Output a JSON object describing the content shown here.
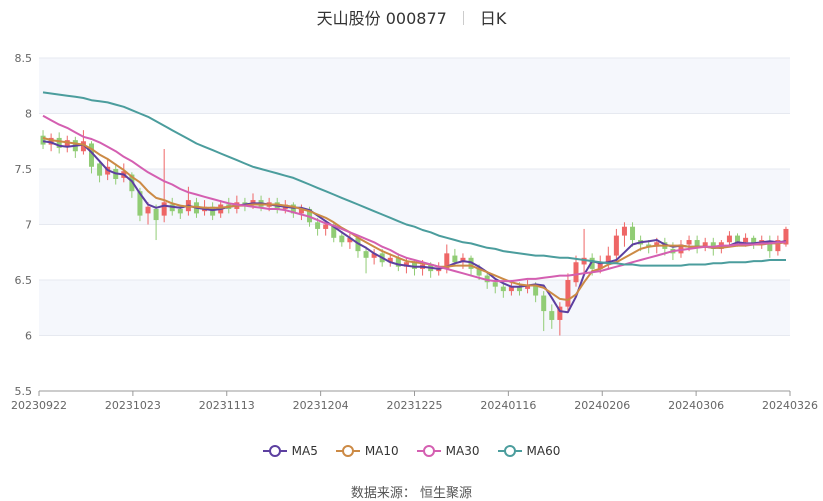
{
  "header": {
    "stock": "天山股份 000877",
    "period": "日K"
  },
  "source": "数据来源： 恒生聚源",
  "colors": {
    "up": "#ee6666",
    "down": "#91cc75",
    "grid_band": "#f5f7fc"
  },
  "chart_data": {
    "type": "candlestick",
    "title": "天山股份 000877",
    "ylim": [
      5.5,
      8.5
    ],
    "yticks": [
      "5.5",
      "6",
      "6.5",
      "7",
      "7.5",
      "8",
      "8.5"
    ],
    "x_tick_labels": [
      "20230922",
      "20231023",
      "20231113",
      "20231204",
      "20231225",
      "20240116",
      "20240206",
      "20240306",
      "20240326"
    ],
    "grid": true,
    "legend_position": "bottom",
    "series": [
      {
        "name": "MA5",
        "color": "#5c3fa0",
        "values": [
          7.75,
          7.74,
          7.71,
          7.7,
          7.71,
          7.72,
          7.65,
          7.57,
          7.49,
          7.46,
          7.45,
          7.39,
          7.28,
          7.18,
          7.15,
          7.17,
          7.16,
          7.15,
          7.17,
          7.15,
          7.14,
          7.13,
          7.14,
          7.16,
          7.17,
          7.18,
          7.19,
          7.19,
          7.18,
          7.17,
          7.16,
          7.15,
          7.15,
          7.13,
          7.08,
          7.03,
          6.98,
          6.93,
          6.88,
          6.83,
          6.79,
          6.74,
          6.7,
          6.66,
          6.64,
          6.63,
          6.62,
          6.62,
          6.61,
          6.6,
          6.62,
          6.65,
          6.67,
          6.66,
          6.62,
          6.57,
          6.51,
          6.47,
          6.44,
          6.44,
          6.45,
          6.46,
          6.45,
          6.34,
          6.22,
          6.21,
          6.35,
          6.55,
          6.67,
          6.65,
          6.66,
          6.68,
          6.75,
          6.82,
          6.84,
          6.85,
          6.86,
          6.82,
          6.8,
          6.81,
          6.8,
          6.8,
          6.8,
          6.79,
          6.79,
          6.81,
          6.84,
          6.83,
          6.83,
          6.84,
          6.85,
          6.84,
          6.85
        ]
      },
      {
        "name": "MA10",
        "color": "#cc8a45",
        "values": [
          7.78,
          7.76,
          7.75,
          7.74,
          7.73,
          7.72,
          7.68,
          7.63,
          7.59,
          7.54,
          7.49,
          7.43,
          7.38,
          7.3,
          7.24,
          7.22,
          7.19,
          7.17,
          7.16,
          7.16,
          7.15,
          7.15,
          7.15,
          7.16,
          7.17,
          7.17,
          7.18,
          7.18,
          7.18,
          7.18,
          7.17,
          7.16,
          7.14,
          7.12,
          7.09,
          7.06,
          7.02,
          6.97,
          6.93,
          6.88,
          6.84,
          6.8,
          6.76,
          6.73,
          6.7,
          6.67,
          6.66,
          6.65,
          6.64,
          6.62,
          6.62,
          6.63,
          6.63,
          6.63,
          6.6,
          6.57,
          6.54,
          6.51,
          6.48,
          6.46,
          6.45,
          6.45,
          6.43,
          6.38,
          6.33,
          6.32,
          6.37,
          6.48,
          6.58,
          6.6,
          6.64,
          6.66,
          6.7,
          6.74,
          6.78,
          6.8,
          6.81,
          6.81,
          6.81,
          6.81,
          6.8,
          6.8,
          6.8,
          6.79,
          6.79,
          6.8,
          6.81,
          6.81,
          6.82,
          6.82,
          6.83,
          6.83,
          6.84
        ]
      },
      {
        "name": "MA30",
        "color": "#d45fb1",
        "values": [
          7.98,
          7.94,
          7.9,
          7.87,
          7.83,
          7.79,
          7.77,
          7.74,
          7.7,
          7.66,
          7.61,
          7.57,
          7.52,
          7.47,
          7.43,
          7.39,
          7.36,
          7.32,
          7.29,
          7.27,
          7.25,
          7.23,
          7.21,
          7.19,
          7.18,
          7.17,
          7.16,
          7.15,
          7.14,
          7.14,
          7.13,
          7.11,
          7.09,
          7.07,
          7.04,
          7.01,
          6.99,
          6.96,
          6.93,
          6.9,
          6.87,
          6.84,
          6.8,
          6.77,
          6.73,
          6.7,
          6.68,
          6.66,
          6.64,
          6.62,
          6.6,
          6.58,
          6.56,
          6.54,
          6.52,
          6.5,
          6.49,
          6.49,
          6.49,
          6.5,
          6.51,
          6.51,
          6.52,
          6.53,
          6.54,
          6.54,
          6.55,
          6.56,
          6.57,
          6.58,
          6.6,
          6.62,
          6.64,
          6.66,
          6.68,
          6.7,
          6.72,
          6.74,
          6.76,
          6.77,
          6.78,
          6.79,
          6.8,
          6.8,
          6.81,
          6.81,
          6.82,
          6.82,
          6.82,
          6.83,
          6.83,
          6.84,
          6.84
        ]
      },
      {
        "name": "MA60",
        "color": "#4b9d9d",
        "values": [
          8.19,
          8.18,
          8.17,
          8.16,
          8.15,
          8.14,
          8.12,
          8.11,
          8.1,
          8.08,
          8.06,
          8.03,
          8.0,
          7.97,
          7.93,
          7.89,
          7.85,
          7.81,
          7.77,
          7.73,
          7.7,
          7.67,
          7.64,
          7.61,
          7.58,
          7.55,
          7.52,
          7.5,
          7.48,
          7.46,
          7.44,
          7.42,
          7.39,
          7.36,
          7.33,
          7.3,
          7.27,
          7.24,
          7.21,
          7.18,
          7.15,
          7.12,
          7.09,
          7.06,
          7.03,
          7.0,
          6.98,
          6.95,
          6.93,
          6.9,
          6.88,
          6.86,
          6.84,
          6.83,
          6.81,
          6.79,
          6.78,
          6.76,
          6.75,
          6.74,
          6.73,
          6.72,
          6.72,
          6.71,
          6.7,
          6.7,
          6.69,
          6.68,
          6.67,
          6.66,
          6.65,
          6.65,
          6.64,
          6.64,
          6.63,
          6.63,
          6.63,
          6.63,
          6.63,
          6.63,
          6.64,
          6.64,
          6.64,
          6.65,
          6.65,
          6.66,
          6.66,
          6.66,
          6.67,
          6.67,
          6.68,
          6.68,
          6.68
        ]
      }
    ],
    "candles": [
      [
        7.8,
        7.72,
        7.68,
        7.85
      ],
      [
        7.72,
        7.78,
        7.66,
        7.82
      ],
      [
        7.78,
        7.69,
        7.64,
        7.83
      ],
      [
        7.7,
        7.76,
        7.65,
        7.8
      ],
      [
        7.76,
        7.66,
        7.6,
        7.79
      ],
      [
        7.66,
        7.75,
        7.63,
        7.85
      ],
      [
        7.73,
        7.52,
        7.46,
        7.75
      ],
      [
        7.55,
        7.44,
        7.38,
        7.58
      ],
      [
        7.45,
        7.52,
        7.4,
        7.6
      ],
      [
        7.5,
        7.41,
        7.36,
        7.55
      ],
      [
        7.42,
        7.48,
        7.38,
        7.55
      ],
      [
        7.45,
        7.3,
        7.24,
        7.47
      ],
      [
        7.3,
        7.08,
        7.03,
        7.33
      ],
      [
        7.1,
        7.16,
        7.0,
        7.2
      ],
      [
        7.14,
        7.04,
        6.86,
        7.18
      ],
      [
        7.08,
        7.2,
        7.02,
        7.68
      ],
      [
        7.18,
        7.12,
        7.08,
        7.24
      ],
      [
        7.14,
        7.1,
        7.05,
        7.18
      ],
      [
        7.12,
        7.22,
        7.08,
        7.34
      ],
      [
        7.2,
        7.1,
        7.06,
        7.24
      ],
      [
        7.12,
        7.16,
        7.08,
        7.22
      ],
      [
        7.16,
        7.08,
        7.04,
        7.2
      ],
      [
        7.1,
        7.18,
        7.06,
        7.22
      ],
      [
        7.18,
        7.14,
        7.1,
        7.24
      ],
      [
        7.14,
        7.2,
        7.1,
        7.26
      ],
      [
        7.2,
        7.18,
        7.12,
        7.24
      ],
      [
        7.18,
        7.22,
        7.14,
        7.28
      ],
      [
        7.22,
        7.16,
        7.12,
        7.26
      ],
      [
        7.16,
        7.2,
        7.12,
        7.24
      ],
      [
        7.2,
        7.14,
        7.1,
        7.24
      ],
      [
        7.14,
        7.18,
        7.1,
        7.22
      ],
      [
        7.18,
        7.1,
        7.06,
        7.2
      ],
      [
        7.1,
        7.14,
        7.04,
        7.18
      ],
      [
        7.14,
        7.02,
        6.98,
        7.16
      ],
      [
        7.02,
        6.96,
        6.9,
        7.06
      ],
      [
        6.96,
        7.0,
        6.9,
        7.04
      ],
      [
        7.0,
        6.88,
        6.84,
        7.02
      ],
      [
        6.9,
        6.84,
        6.8,
        6.94
      ],
      [
        6.84,
        6.88,
        6.78,
        6.92
      ],
      [
        6.88,
        6.76,
        6.7,
        6.9
      ],
      [
        6.76,
        6.7,
        6.56,
        6.8
      ],
      [
        6.7,
        6.74,
        6.64,
        6.78
      ],
      [
        6.74,
        6.66,
        6.62,
        6.78
      ],
      [
        6.66,
        6.7,
        6.62,
        6.74
      ],
      [
        6.7,
        6.62,
        6.58,
        6.74
      ],
      [
        6.62,
        6.66,
        6.56,
        6.7
      ],
      [
        6.66,
        6.6,
        6.54,
        6.68
      ],
      [
        6.6,
        6.64,
        6.54,
        6.68
      ],
      [
        6.64,
        6.58,
        6.52,
        6.66
      ],
      [
        6.58,
        6.6,
        6.54,
        6.66
      ],
      [
        6.6,
        6.74,
        6.56,
        6.82
      ],
      [
        6.72,
        6.66,
        6.62,
        6.78
      ],
      [
        6.66,
        6.7,
        6.6,
        6.74
      ],
      [
        6.7,
        6.6,
        6.54,
        6.72
      ],
      [
        6.6,
        6.54,
        6.5,
        6.64
      ],
      [
        6.54,
        6.48,
        6.42,
        6.58
      ],
      [
        6.48,
        6.44,
        6.38,
        6.52
      ],
      [
        6.44,
        6.4,
        6.34,
        6.48
      ],
      [
        6.4,
        6.44,
        6.36,
        6.5
      ],
      [
        6.44,
        6.4,
        6.36,
        6.48
      ],
      [
        6.42,
        6.46,
        6.38,
        6.5
      ],
      [
        6.46,
        6.36,
        6.3,
        6.48
      ],
      [
        6.36,
        6.22,
        6.04,
        6.4
      ],
      [
        6.22,
        6.14,
        6.06,
        6.28
      ],
      [
        6.14,
        6.26,
        6.0,
        6.3
      ],
      [
        6.26,
        6.5,
        6.22,
        6.56
      ],
      [
        6.48,
        6.66,
        6.44,
        6.72
      ],
      [
        6.64,
        6.7,
        6.56,
        6.96
      ],
      [
        6.7,
        6.6,
        6.54,
        6.74
      ],
      [
        6.6,
        6.66,
        6.56,
        6.72
      ],
      [
        6.66,
        6.72,
        6.6,
        6.8
      ],
      [
        6.72,
        6.9,
        6.66,
        6.96
      ],
      [
        6.9,
        6.98,
        6.8,
        7.02
      ],
      [
        6.98,
        6.86,
        6.8,
        7.02
      ],
      [
        6.86,
        6.82,
        6.76,
        6.9
      ],
      [
        6.82,
        6.8,
        6.74,
        6.86
      ],
      [
        6.8,
        6.84,
        6.74,
        6.88
      ],
      [
        6.84,
        6.78,
        6.72,
        6.88
      ],
      [
        6.78,
        6.74,
        6.68,
        6.84
      ],
      [
        6.74,
        6.82,
        6.7,
        6.86
      ],
      [
        6.82,
        6.86,
        6.76,
        6.9
      ],
      [
        6.86,
        6.8,
        6.74,
        6.9
      ],
      [
        6.8,
        6.84,
        6.76,
        6.88
      ],
      [
        6.84,
        6.78,
        6.72,
        6.88
      ],
      [
        6.78,
        6.84,
        6.74,
        6.86
      ],
      [
        6.84,
        6.9,
        6.8,
        6.94
      ],
      [
        6.9,
        6.84,
        6.8,
        6.92
      ],
      [
        6.84,
        6.88,
        6.8,
        6.92
      ],
      [
        6.88,
        6.82,
        6.78,
        6.9
      ],
      [
        6.82,
        6.86,
        6.78,
        6.9
      ],
      [
        6.84,
        6.76,
        6.7,
        6.9
      ],
      [
        6.76,
        6.86,
        6.72,
        6.9
      ],
      [
        6.82,
        6.96,
        6.8,
        6.98
      ]
    ]
  },
  "legend": [
    {
      "label": "MA5",
      "color": "#5c3fa0"
    },
    {
      "label": "MA10",
      "color": "#cc8a45"
    },
    {
      "label": "MA30",
      "color": "#d45fb1"
    },
    {
      "label": "MA60",
      "color": "#4b9d9d"
    }
  ]
}
